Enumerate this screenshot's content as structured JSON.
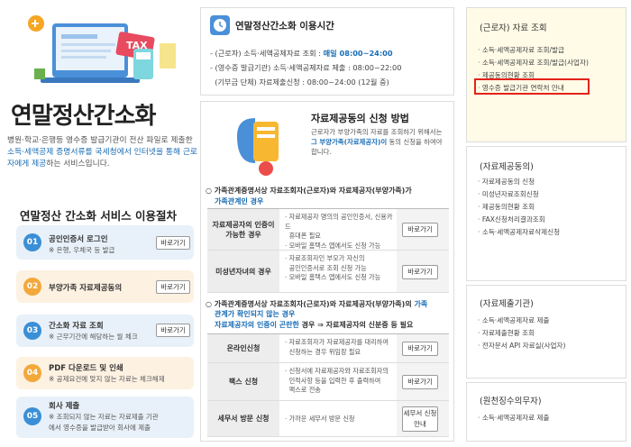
{
  "left": {
    "title": "연말정산간소화",
    "intro_parts": [
      "병원·학교·은행등 영수증 발급기관이 전산 파일로 제출한 ",
      "소득·세액공제 증명서류를 국세청에서 인터넷을 통해 근로자에게 제공",
      "하는 서비스입니다."
    ],
    "tax_badge": "TAX",
    "process_title": "연말정산 간소화 서비스 이용절차",
    "steps": [
      {
        "num": "01",
        "title": "공인인증서 로그인",
        "sub": "※ 은행, 우체국 등 발급",
        "btn": "바로가기",
        "color": "#3a8fd6"
      },
      {
        "num": "02",
        "title": "부양가족 자료제공동의",
        "sub": "",
        "btn": "바로가기",
        "color": "#f2a83a"
      },
      {
        "num": "03",
        "title": "간소화 자료 조회",
        "sub": "※ 근무기간에 해당하는 월 체크",
        "btn": "바로가기",
        "color": "#3a8fd6"
      },
      {
        "num": "04",
        "title": "PDF 다운로드 및 인쇄",
        "sub": "※ 공제요건에 맞지 않는 자료는 체크해제",
        "btn": "",
        "color": "#f2a83a"
      },
      {
        "num": "05",
        "title": "회사 제출",
        "sub": "※ 조회되지 않는 자료는 자료제출 기관",
        "sub2": "에서 영수증을 발급받아 회사에 제출",
        "btn": "",
        "color": "#3a8fd6"
      }
    ]
  },
  "hours": {
    "title": "연말정산간소화 이용시간",
    "lines": [
      {
        "pre": "- (근로자) 소득·세액공제자료 조회 : ",
        "val": "매일 08:00~24:00"
      },
      {
        "pre": "- (영수증 발급기관) 소득·세액공제자료 제출 : ",
        "val": "08:00~22:00"
      },
      {
        "pre": "  (기부금 단체) 자료제출신청 : ",
        "val": "08:00~24:00 (12월 중)"
      }
    ]
  },
  "consent": {
    "title": "자료제공동의 신청 방법",
    "desc1": "근로자가 부양가족의 자료를 조회하기 위해서는",
    "desc2_hl": "그 부양가족(자료제공자)이",
    "desc2_rest": " 동의 신청을 하여야",
    "desc3": "합니다.",
    "sec1_a": "가족관계증명서상 자료조회자(근로자)와 자료제공자(부양가족)가",
    "sec1_b": "가족관계인 경우",
    "rows1": [
      {
        "label": "자료제공자의 인증이 가능한 경우",
        "d": [
          "· 자료제공자 명의의 공인인증서, 신용카드",
          "  휴대폰 필요",
          "· 모바일 홈택스 앱에서도 신청 가능"
        ],
        "btn": "바로가기"
      },
      {
        "label": "미성년자녀의 경우",
        "d": [
          "· 자료조회자인 부모가 자신의",
          "  공인인증서로 조회 신청 가능",
          "· 모바일 홈택스 앱에서도 신청 가능"
        ],
        "btn": "바로가기"
      }
    ],
    "sec2_a": "가족관계증명서상 자료조회자(근로자)와 자료제공자(부양가족)의",
    "sec2_a_hl": " 가족",
    "sec2_b": "관계가 확인되지 않는 경우",
    "sec2_c_hl": "자료제공자의 인증이 곤란한",
    "sec2_c_rest": " 경우 ⇒ 자료제공자의 신분증 등 필요",
    "rows2": [
      {
        "label": "온라인신청",
        "d": [
          "· 자료조회자가 자료제공자를 대리하여",
          "  신청하는 경우 위임장 필요"
        ],
        "btn": "바로가기"
      },
      {
        "label": "팩스 신청",
        "d": [
          "· 신청서에 자료제공자와 자료조회자의",
          "  인적사항 등을 입력한 후 출력하여",
          "  팩스로 전송"
        ],
        "btn": "바로가기"
      },
      {
        "label": "세무서 방문 신청",
        "d": [
          "· 가까운 세무서 방문 신청"
        ],
        "btn": "세무서 신청안내"
      }
    ]
  },
  "right": [
    {
      "title": "(근로자) 자료 조회",
      "items": [
        "소득·세액공제자료 조회/발급",
        "소득·세액공제자료 조회/발급(사업자)",
        "제공동의현황 조회",
        "영수증 발급기관 연락처 안내"
      ],
      "highlight": 3
    },
    {
      "title": "(자료제공동의)",
      "items": [
        "자료제공동의 신청",
        "미성년자료조회신청",
        "제공동의현황 조회",
        "FAX신청처리결과조회",
        "소득·세액공제자료삭제신청"
      ]
    },
    {
      "title": "(자료제출기관)",
      "items": [
        "소득·세액공제자료 제출",
        "자료제출현황 조회",
        "전자문서 API 자료실(사업자)"
      ]
    },
    {
      "title": "(원천징수의무자)",
      "items": [
        "소득·세액공제자료 제출"
      ]
    }
  ],
  "colors": {
    "accent": "#1a6db5",
    "highlight_box": "#e2231a",
    "yellow_panel": "#fffbe6"
  }
}
